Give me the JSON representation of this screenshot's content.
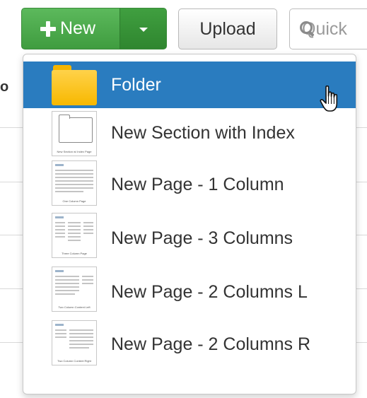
{
  "toolbar": {
    "new_label": "New",
    "upload_label": "Upload",
    "search_placeholder": "Quick"
  },
  "background": {
    "header_fragment": "o"
  },
  "dropdown": {
    "items": [
      {
        "label": "Folder",
        "icon": "folder-icon",
        "active": true
      },
      {
        "label": "New Section with Index",
        "icon": "section-index-thumbnail",
        "thumb_caption": "New Section w/ Index Page"
      },
      {
        "label": "New Page - 1 Column",
        "icon": "one-column-page-thumbnail",
        "thumb_caption": "One Column Page"
      },
      {
        "label": "New Page - 3 Columns",
        "icon": "three-column-page-thumbnail",
        "thumb_caption": "Three Column Page"
      },
      {
        "label": "New Page - 2 Columns L",
        "icon": "two-column-left-thumbnail",
        "thumb_caption": "Two Column Content Left"
      },
      {
        "label": "New Page - 2 Columns R",
        "icon": "two-column-right-thumbnail",
        "thumb_caption": "Two Column Content Right"
      }
    ]
  },
  "colors": {
    "new_button": "#4cae4c",
    "menu_active": "#2a7cbf",
    "folder": "#f7b800"
  }
}
